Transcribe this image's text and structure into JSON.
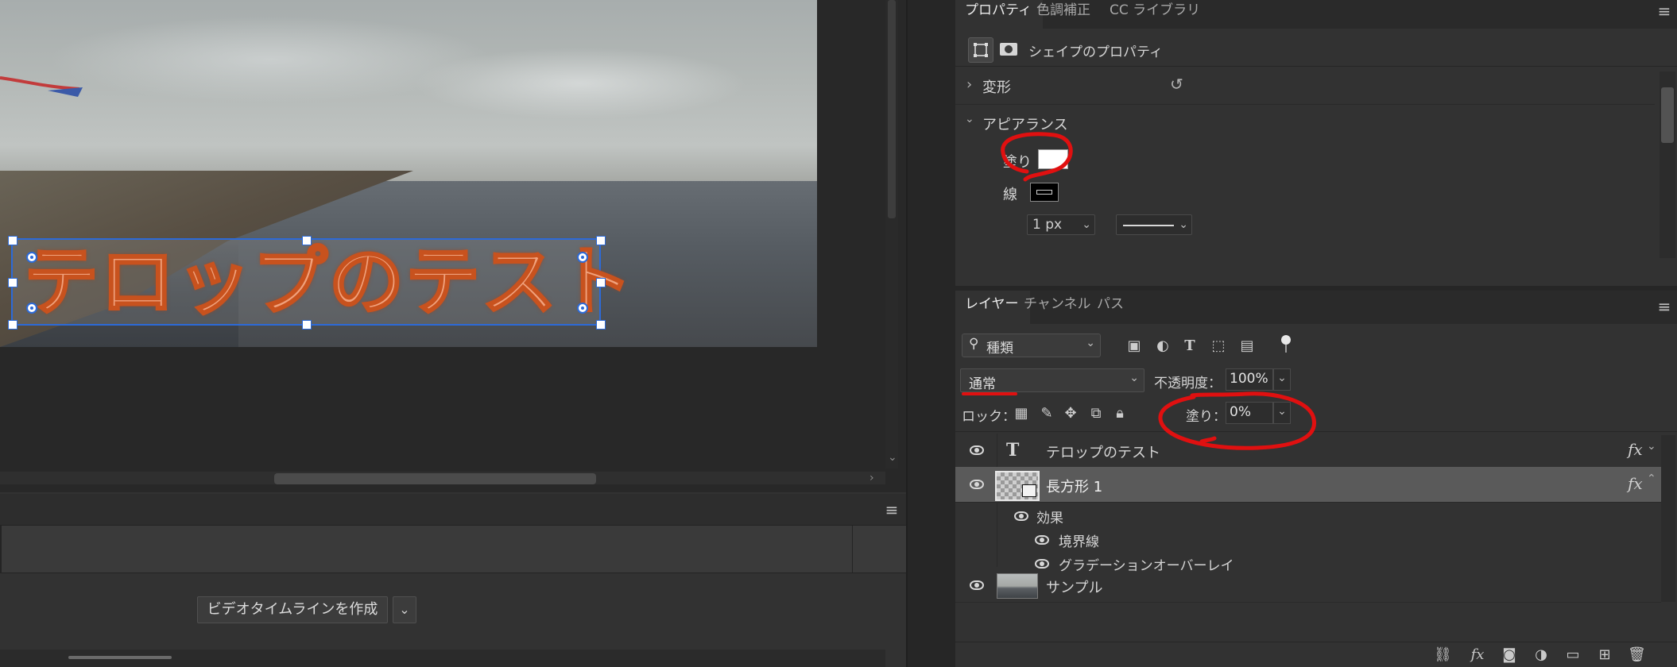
{
  "canvas": {
    "telop_text": "テロップのテスト"
  },
  "timeline": {
    "create_button": "ビデオタイムラインを作成"
  },
  "properties": {
    "tabs": [
      "プロパティ",
      "色調補正",
      "CC ライブラリ"
    ],
    "active_tab": "プロパティ",
    "shape_title": "シェイプのプロパティ",
    "transform_label": "変形",
    "appearance_label": "アピアランス",
    "fill_label": "塗り",
    "fill_color": "#ffffff",
    "stroke_label": "線",
    "stroke_color": "#000000",
    "stroke_width": "1 px"
  },
  "layers": {
    "tabs": [
      "レイヤー",
      "チャンネル",
      "パス"
    ],
    "active_tab": "レイヤー",
    "filter_kind": "種類",
    "blend_mode": "通常",
    "opacity_label": "不透明度：",
    "opacity_value": "100%",
    "lock_label": "ロック：",
    "fill_label": "塗り：",
    "fill_value": "0%",
    "items": [
      {
        "name": "テロップのテスト",
        "type": "text",
        "fx": "fx"
      },
      {
        "name": "長方形 1",
        "type": "shape",
        "fx": "fx",
        "selected": true
      },
      {
        "name": "効果",
        "type": "effects-group"
      },
      {
        "name": "境界線",
        "type": "effect"
      },
      {
        "name": "グラデーションオーバーレイ",
        "type": "effect"
      },
      {
        "name": "サンプル",
        "type": "image"
      }
    ]
  },
  "colors": {
    "selection": "#2c6ad8",
    "annotation": "#e01010",
    "panel_bg": "#323232"
  }
}
